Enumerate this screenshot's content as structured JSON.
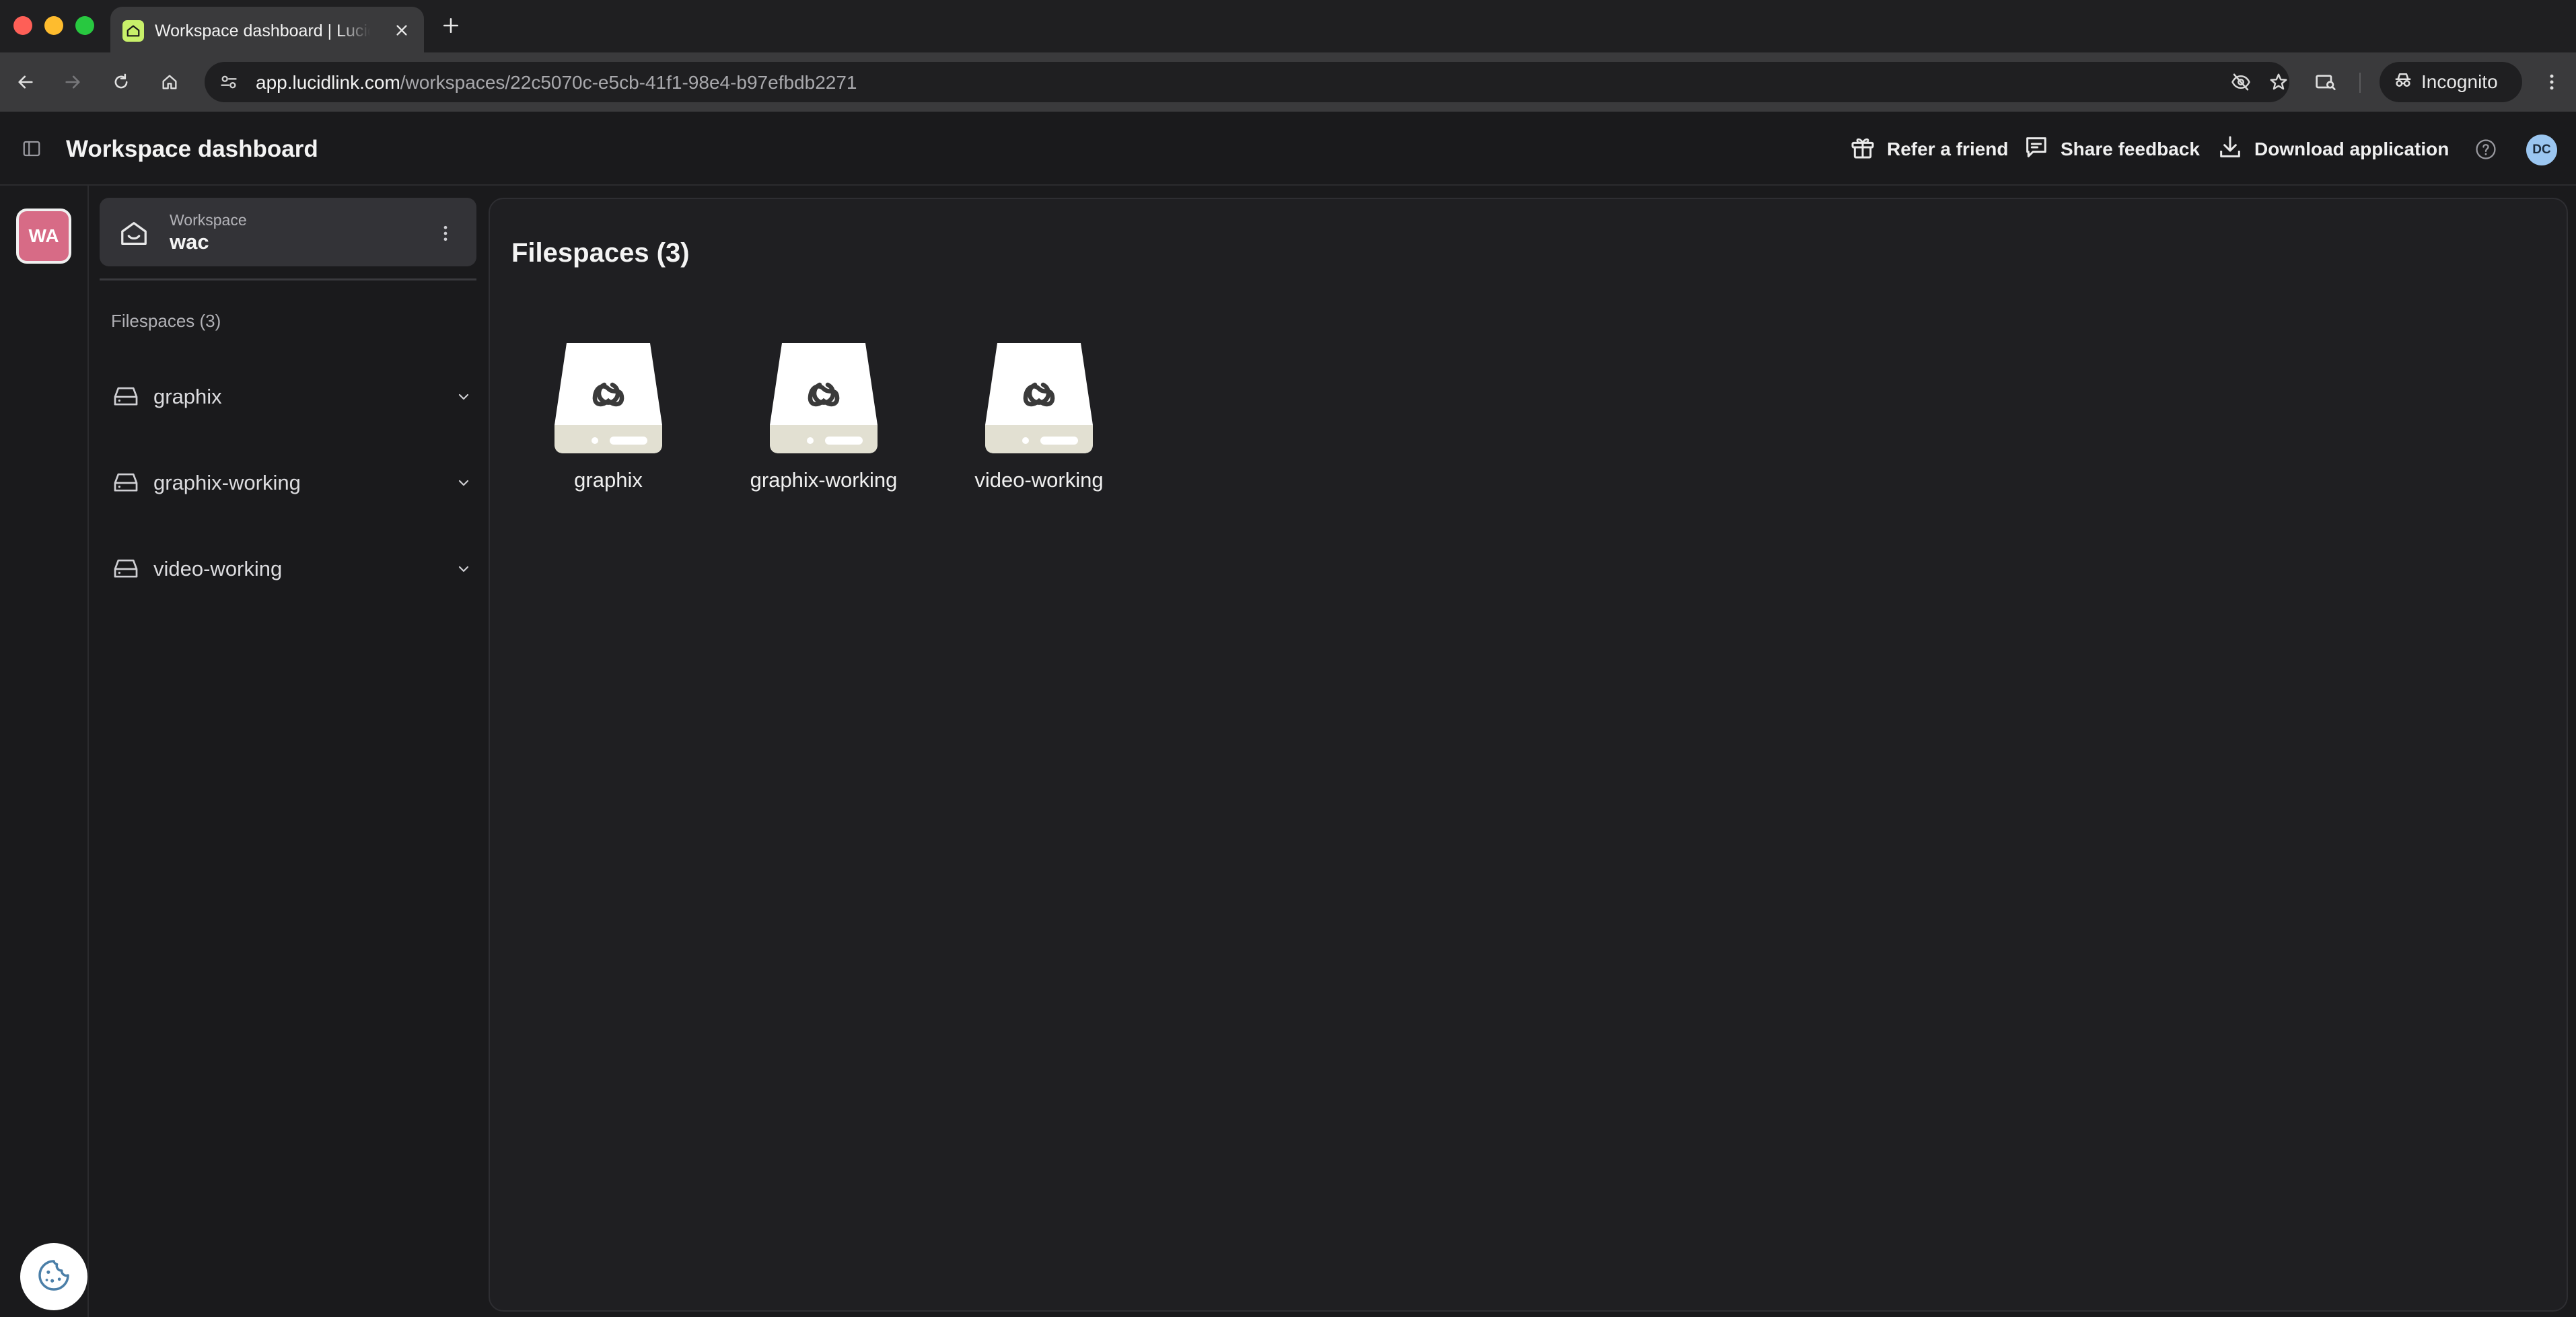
{
  "browser": {
    "tab_title": "Workspace dashboard | LucidLink",
    "url_host": "app.lucidlink.com",
    "url_path": "/workspaces/22c5070c-e5cb-41f1-98e4-b97efbdb2271",
    "incognito_label": "Incognito"
  },
  "header": {
    "title": "Workspace dashboard",
    "actions": {
      "refer": "Refer a friend",
      "feedback": "Share feedback",
      "download": "Download application"
    },
    "user_initials": "DC"
  },
  "rail": {
    "workspace_initials": "WA"
  },
  "sidebar": {
    "workspace_label": "Workspace",
    "workspace_name": "wac",
    "section_label": "Filespaces (3)",
    "filespaces": [
      {
        "name": "graphix"
      },
      {
        "name": "graphix-working"
      },
      {
        "name": "video-working"
      }
    ]
  },
  "main": {
    "title": "Filespaces (3)",
    "tiles": [
      {
        "name": "graphix"
      },
      {
        "name": "graphix-working"
      },
      {
        "name": "video-working"
      }
    ]
  },
  "colors": {
    "workspace_avatar": "#d76b86",
    "user_avatar": "#9bc6f0",
    "favicon": "#c8f06a"
  }
}
